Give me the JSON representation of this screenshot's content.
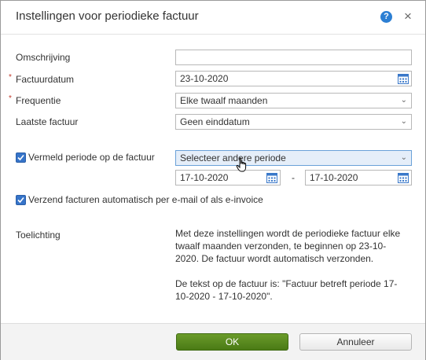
{
  "dialog": {
    "title": "Instellingen voor periodieke factuur",
    "help_icon": "?",
    "close_icon": "×"
  },
  "form": {
    "omschrijving": {
      "label": "Omschrijving",
      "value": ""
    },
    "factuurdatum": {
      "required_mark": "*",
      "label": "Factuurdatum",
      "value": "23-10-2020"
    },
    "frequentie": {
      "required_mark": "*",
      "label": "Frequentie",
      "value": "Elke twaalf maanden"
    },
    "laatste_factuur": {
      "label": "Laatste factuur",
      "value": "Geen einddatum"
    },
    "vermeld_periode": {
      "label": "Vermeld periode op de factuur",
      "checked": true,
      "select_value": "Selecteer andere periode",
      "from": "17-10-2020",
      "separator": "-",
      "to": "17-10-2020"
    },
    "verzend_automatisch": {
      "label": "Verzend facturen automatisch per e-mail of als e-invoice",
      "checked": true
    },
    "toelichting": {
      "label": "Toelichting",
      "paragraph1": "Met deze instellingen wordt de periodieke factuur elke twaalf maanden verzonden, te beginnen op 23-10-2020. De factuur wordt automatisch verzonden.",
      "paragraph2": "De tekst op de factuur is: \"Factuur betreft periode 17-10-2020 - 17-10-2020\"."
    }
  },
  "footer": {
    "ok_label": "OK",
    "cancel_label": "Annuleer"
  },
  "icons": {
    "calendar": "calendar-icon",
    "chevron": "chevron-down-icon",
    "checkbox": "checkmark-icon"
  },
  "colors": {
    "ok_button": "#5a8a1f",
    "checkbox": "#3674c9",
    "required": "#c0392b",
    "active_select": "#e5eef9"
  }
}
